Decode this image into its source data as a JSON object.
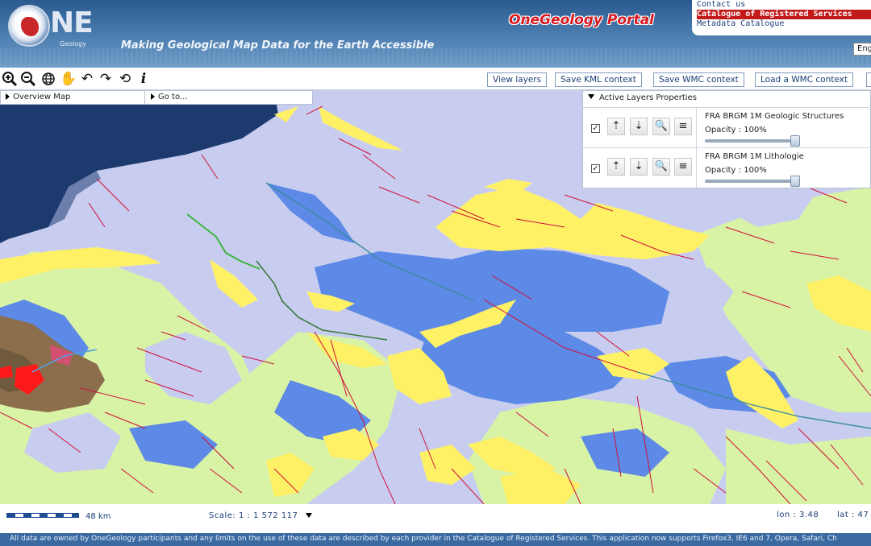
{
  "header": {
    "logo_text": "NE",
    "logo_sub": "Geology",
    "tagline": "Making Geological Map Data for the Earth Accessible",
    "portal_title": "OneGeology Portal",
    "links": [
      "Contact us",
      "Catalogue of Registered Services",
      "Metadata Catalogue"
    ],
    "language": "Eng"
  },
  "toolbar": {
    "tools": [
      "zoom-in-icon",
      "zoom-out-icon",
      "globe-icon",
      "pan-hand-icon",
      "undo-icon",
      "redo-icon",
      "refresh-icon",
      "info-icon"
    ],
    "buttons": [
      "View layers",
      "Save KML context",
      "Save WMC context",
      "Load a WMC context"
    ]
  },
  "overview": {
    "overview_label": "Overview Map",
    "goto_label": "Go to..."
  },
  "layers_panel": {
    "title": "Active Layers Properties",
    "layers": [
      {
        "name": "FRA BRGM 1M Geologic Structures",
        "opacity_label": "Opacity : 100%",
        "opacity": 1.0,
        "checked": true
      },
      {
        "name": "FRA BRGM 1M Lithologie",
        "opacity_label": "Opacity : 100%",
        "opacity": 1.0,
        "checked": true
      }
    ]
  },
  "status": {
    "scale_km": "48 km",
    "scale_label": "Scale: 1 : 1 572 117",
    "lon_label": "lon : 3.48",
    "lat_label": "lat : 47"
  },
  "footer": {
    "text": "All data are owned by OneGeology participants and any limits on the use of these data are described by each provider in the Catalogue of Registered Services. This application now supports Firefox3, IE6 and 7, Opera, Safari, Ch"
  },
  "colors": {
    "sea": "#1c3a6e",
    "lavender": "#c8cdf0",
    "blue_lake": "#5c8ae6",
    "yellow": "#fff166",
    "light_green": "#d8f2a6",
    "fault_red": "#d0103a",
    "header_blue": "#3b6aa0"
  }
}
